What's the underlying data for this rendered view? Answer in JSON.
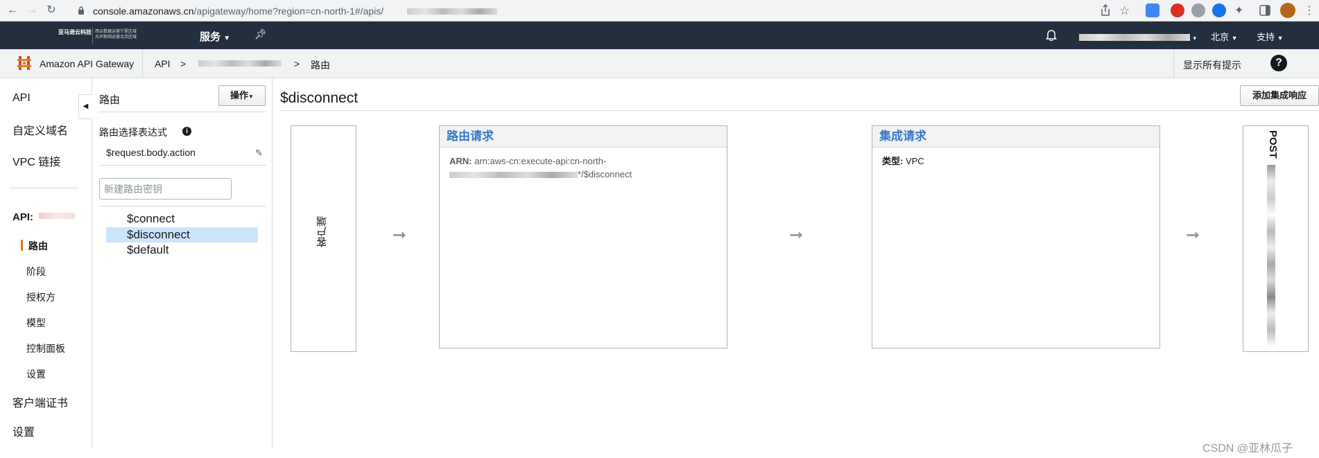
{
  "browser": {
    "url_host": "console.amazonaws.cn",
    "url_path": "/apigateway/home?region=cn-north-1#/apis/"
  },
  "aws_nav": {
    "logo_line1": "亚马逊云科技",
    "logo_line2a": "西云数据运营宁夏区域",
    "logo_line2b": "光环新网运营北京区域",
    "services_label": "服务",
    "region_label": "北京",
    "support_label": "支持"
  },
  "service_bar": {
    "service_name": "Amazon API Gateway",
    "breadcrumb_api": "API",
    "breadcrumb_sep": ">",
    "breadcrumb_current": "路由",
    "show_hints": "显示所有提示",
    "help": "?"
  },
  "left_nav": {
    "items": [
      "API",
      "自定义域名",
      "VPC 链接"
    ],
    "api_label": "API:",
    "sub_items": [
      "路由",
      "阶段",
      "授权方",
      "模型",
      "控制面板",
      "设置"
    ],
    "bottom_items": [
      "客户端证书",
      "设置"
    ]
  },
  "routes_panel": {
    "title": "路由",
    "actions_label": "操作",
    "rse_label": "路由选择表达式",
    "rse_value": "$request.body.action",
    "new_route_placeholder": "新建路由密钥",
    "routes": [
      "$connect",
      "$disconnect",
      "$default"
    ],
    "selected_route": "$disconnect"
  },
  "main": {
    "title": "$disconnect",
    "add_integration_response": "添加集成响应",
    "client_label": "客户端",
    "route_request": {
      "title": "路由请求",
      "arn_label": "ARN:",
      "arn_value_line1": "arn:aws-cn:execute-api:cn-north-",
      "arn_value_suffix": "*/$disconnect"
    },
    "integration_request": {
      "title": "集成请求",
      "type_label": "类型:",
      "type_value": "VPC"
    },
    "backend_label": "POST"
  },
  "watermark": "CSDN @亚林瓜子",
  "colors": {
    "aws_nav_bg": "#232f3e",
    "accent_orange": "#ec7211",
    "link_blue": "#3b78c6",
    "selected_bg": "#cce4fb"
  }
}
